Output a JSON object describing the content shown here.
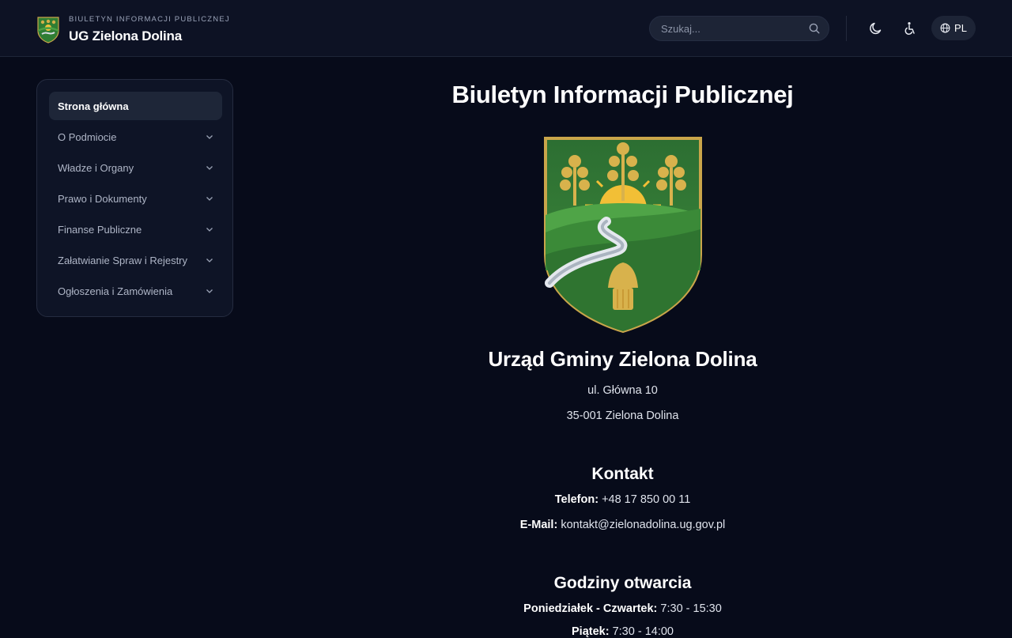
{
  "header": {
    "subtitle": "BIULETYN INFORMACJI PUBLICZNEJ",
    "title": "UG Zielona Dolina",
    "search_placeholder": "Szukaj...",
    "lang_label": "PL"
  },
  "sidebar": {
    "items": [
      {
        "label": "Strona główna"
      },
      {
        "label": "O Podmiocie"
      },
      {
        "label": "Władze i Organy"
      },
      {
        "label": "Prawo i Dokumenty"
      },
      {
        "label": "Finanse Publiczne"
      },
      {
        "label": "Załatwianie Spraw i Rejestry"
      },
      {
        "label": "Ogłoszenia i Zamówienia"
      }
    ]
  },
  "main": {
    "page_title": "Biuletyn Informacji Publicznej",
    "office_name": "Urząd Gminy Zielona Dolina",
    "address_line1": "ul. Główna 10",
    "address_line2": "35-001 Zielona Dolina",
    "contact": {
      "heading": "Kontakt",
      "phone_label": "Telefon:",
      "phone": "+48 17 850 00 11",
      "email_label": "E-Mail:",
      "email": "kontakt@zielonadolina.ug.gov.pl"
    },
    "hours": {
      "heading": "Godziny otwarcia",
      "row1_label": "Poniedziałek - Czwartek:",
      "row1_value": "7:30 - 15:30",
      "row2_label": "Piątek:",
      "row2_value": "7:30 - 14:00"
    }
  },
  "colors": {
    "background": "#070b1a",
    "header_bg": "#0d1224",
    "accent_green": "#3d8a3a",
    "accent_gold": "#d4b04a"
  },
  "icons": [
    "crest-logo",
    "search-icon",
    "moon-icon",
    "accessibility-icon",
    "globe-icon",
    "chevron-down-icon"
  ]
}
